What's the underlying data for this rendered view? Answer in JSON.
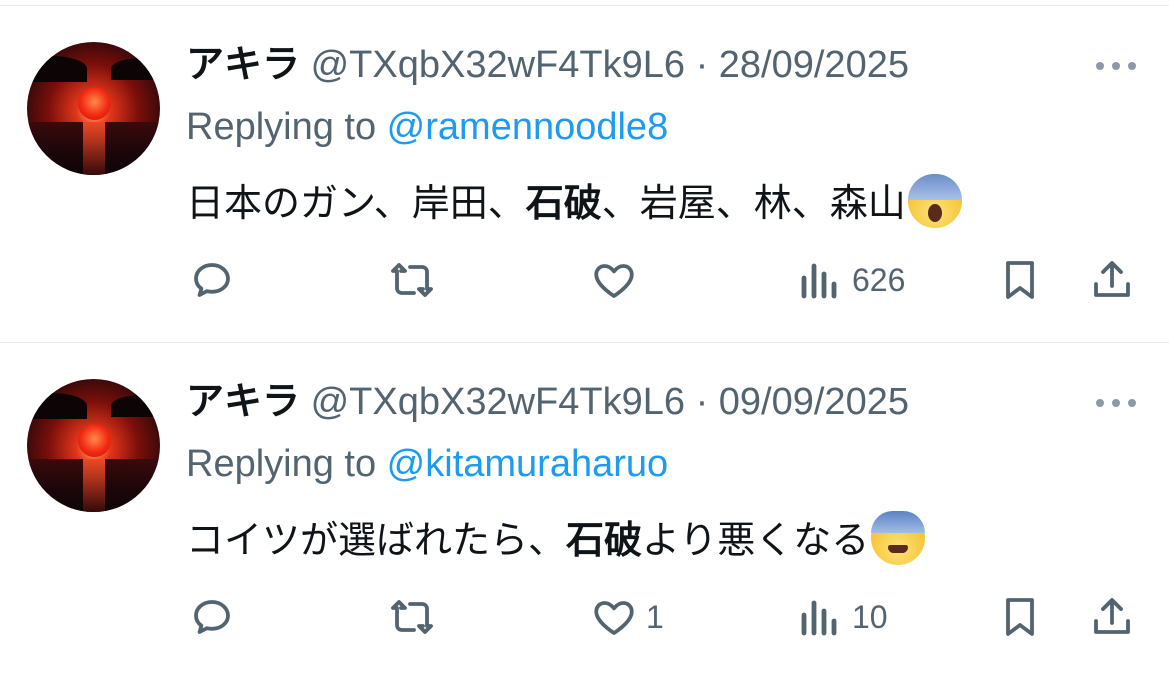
{
  "colors": {
    "text": "#0f1419",
    "secondary": "#536471",
    "accent": "#1d9bf0",
    "divider": "#e6e8ea",
    "icon": "#536471"
  },
  "tweets": [
    {
      "name": "アキラ",
      "handle": "@TXqbX32wF4Tk9L6",
      "separator": "·",
      "date": "28/09/2025",
      "replying_prefix": "Replying to ",
      "replying_to": "@ramennoodle8",
      "body_before": "日本のガン、岸田、",
      "body_bold": "石破",
      "body_after": "、岩屋、林、森山",
      "emoji": "face-screaming-in-fear-emoji",
      "reply_count": "",
      "retweet_count": "",
      "like_count": "",
      "views": "626"
    },
    {
      "name": "アキラ",
      "handle": "@TXqbX32wF4Tk9L6",
      "separator": "·",
      "date": "09/09/2025",
      "replying_prefix": "Replying to ",
      "replying_to": "@kitamuraharuo",
      "body_before": "コイツが選ばれたら、",
      "body_bold": "石破",
      "body_after": "より悪くなる",
      "emoji": "fearful-face-emoji",
      "reply_count": "",
      "retweet_count": "",
      "like_count": "1",
      "views": "10"
    }
  ],
  "icons": {
    "avatar": "sunset-avatar",
    "more": "more-dots-icon",
    "reply": "reply-icon",
    "retweet": "retweet-icon",
    "like": "heart-icon",
    "views": "views-bar-chart-icon",
    "bookmark": "bookmark-icon",
    "share": "share-icon"
  }
}
